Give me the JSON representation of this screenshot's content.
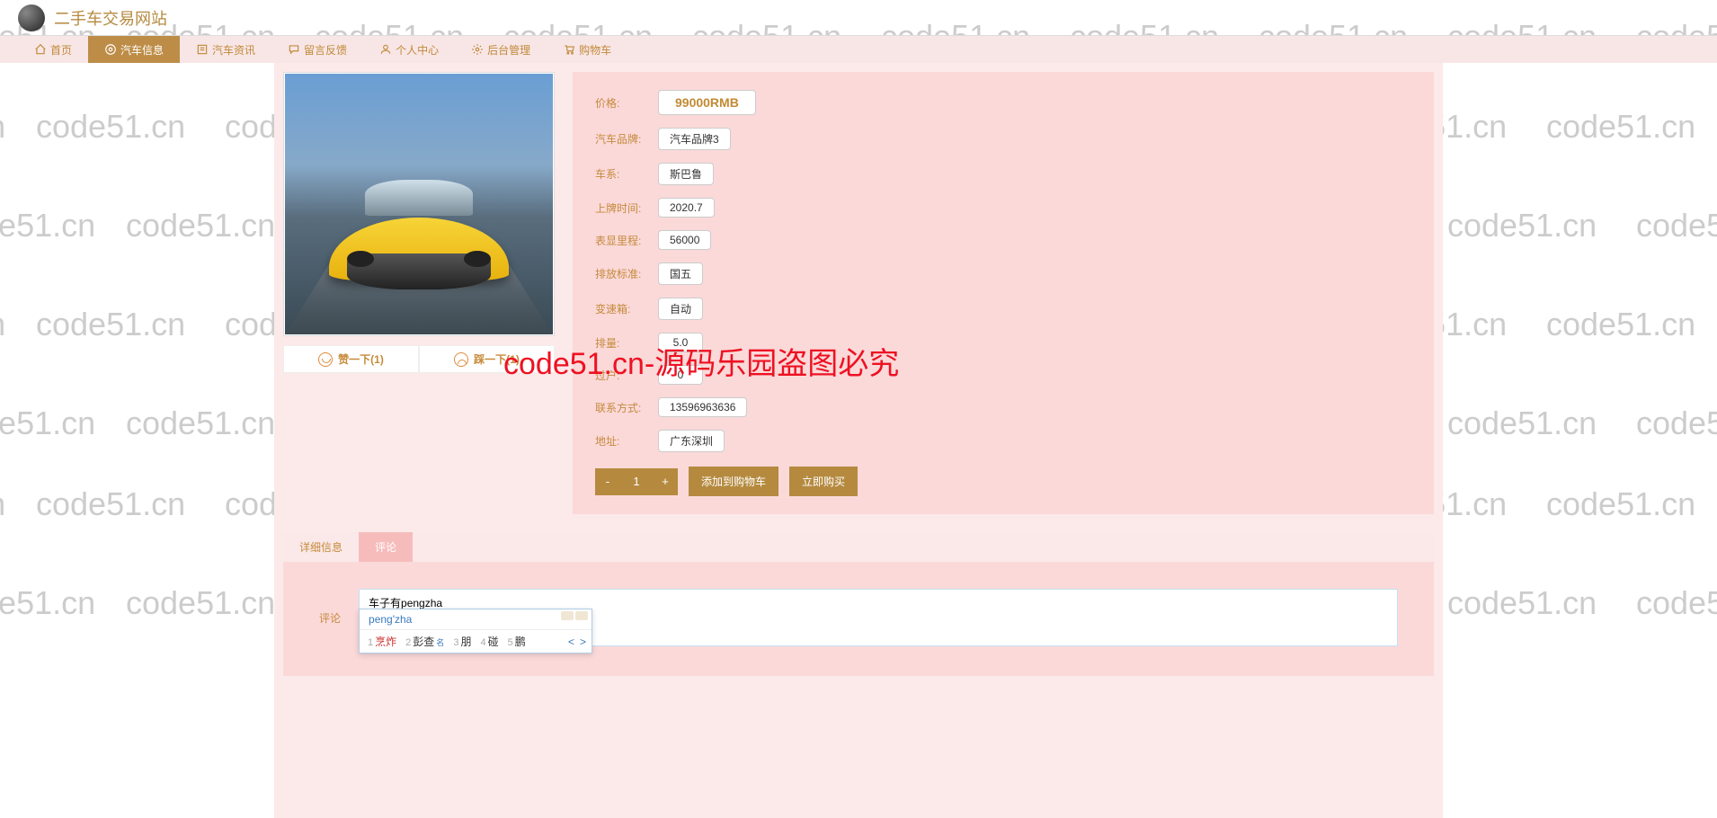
{
  "watermark_text": "code51.cn",
  "big_watermark": "code51.cn-源码乐园盗图必究",
  "header": {
    "site_title": "二手车交易网站"
  },
  "nav": [
    {
      "icon": "home",
      "label": "首页"
    },
    {
      "icon": "car",
      "label": "汽车信息",
      "active": true
    },
    {
      "icon": "news",
      "label": "汽车资讯"
    },
    {
      "icon": "msg",
      "label": "留言反馈"
    },
    {
      "icon": "user",
      "label": "个人中心"
    },
    {
      "icon": "admin",
      "label": "后台管理"
    },
    {
      "icon": "cart",
      "label": "购物车"
    }
  ],
  "vote": {
    "up_label": "赞一下(1)",
    "down_label": "踩一下(1)"
  },
  "details": {
    "price_label": "价格:",
    "price_value": "99000RMB",
    "brand_label": "汽车品牌:",
    "brand_value": "汽车品牌3",
    "series_label": "车系:",
    "series_value": "斯巴鲁",
    "regdate_label": "上牌时间:",
    "regdate_value": "2020.7",
    "mileage_label": "表显里程:",
    "mileage_value": "56000",
    "emission_label": "排放标准:",
    "emission_value": "国五",
    "gearbox_label": "变速箱:",
    "gearbox_value": "自动",
    "displace_label": "排量:",
    "displace_value": "5.0",
    "transfer_label": "过户:",
    "transfer_value": "0",
    "contact_label": "联系方式:",
    "contact_value": "13596963636",
    "addr_label": "地址:",
    "addr_value": "广东深圳"
  },
  "qty": {
    "minus": "-",
    "value": "1",
    "plus": "+"
  },
  "actions": {
    "add_cart": "添加到购物车",
    "buy_now": "立即购买"
  },
  "tabs": {
    "detail": "详细信息",
    "comment": "评论"
  },
  "comment": {
    "label": "评论",
    "input_value": "车子有pengzha"
  },
  "ime": {
    "pinyin": "peng'zha",
    "candidates": [
      {
        "idx": "1",
        "txt": "烹炸",
        "sel": true
      },
      {
        "idx": "2",
        "txt": "彭查",
        "sup": "名"
      },
      {
        "idx": "3",
        "txt": "朋"
      },
      {
        "idx": "4",
        "txt": "碰"
      },
      {
        "idx": "5",
        "txt": "鹏"
      }
    ],
    "nav_prev": "<",
    "nav_next": ">"
  }
}
